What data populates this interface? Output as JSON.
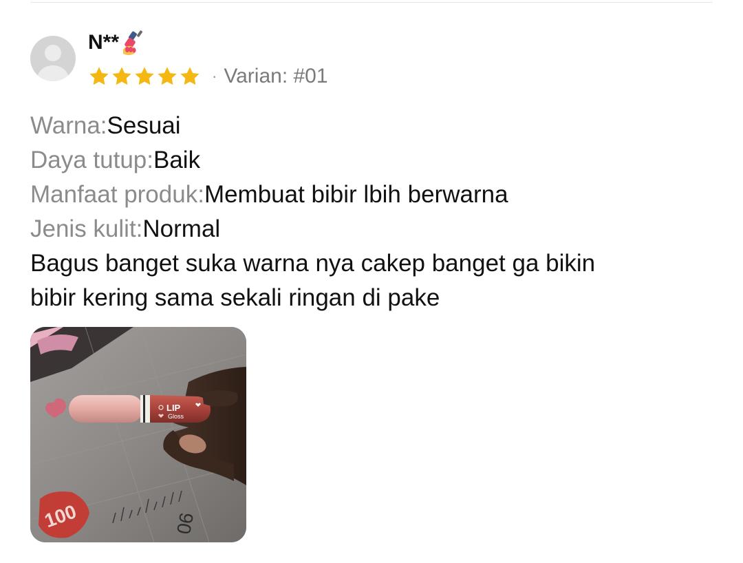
{
  "review": {
    "username": "N**",
    "username_emoji": "nail-polish-emoji",
    "rating": 5,
    "rating_max": 5,
    "separator": "·",
    "variant": "Varian: #01",
    "attributes": [
      {
        "label": "Warna:",
        "value": "Sesuai"
      },
      {
        "label": "Daya tutup:",
        "value": "Baik"
      },
      {
        "label": "Manfaat produk:",
        "value": "Membuat bibir lbih berwarna"
      },
      {
        "label": "Jenis kulit:",
        "value": "Normal"
      }
    ],
    "comment_line1": "Bagus banget suka warna nya cakep banget ga bikin",
    "comment_line2": "bibir kering sama sekali ringan di pake",
    "photo": {
      "product_label_line1": "LIP",
      "product_label_line2": "Gloss",
      "ruler_number": "90",
      "sticker_text": "100"
    }
  },
  "colors": {
    "star": "#f5b712",
    "label": "#8b8b8b",
    "text": "#111111",
    "variant": "#7a7a7a",
    "avatar_bg": "#d4d4d4"
  }
}
